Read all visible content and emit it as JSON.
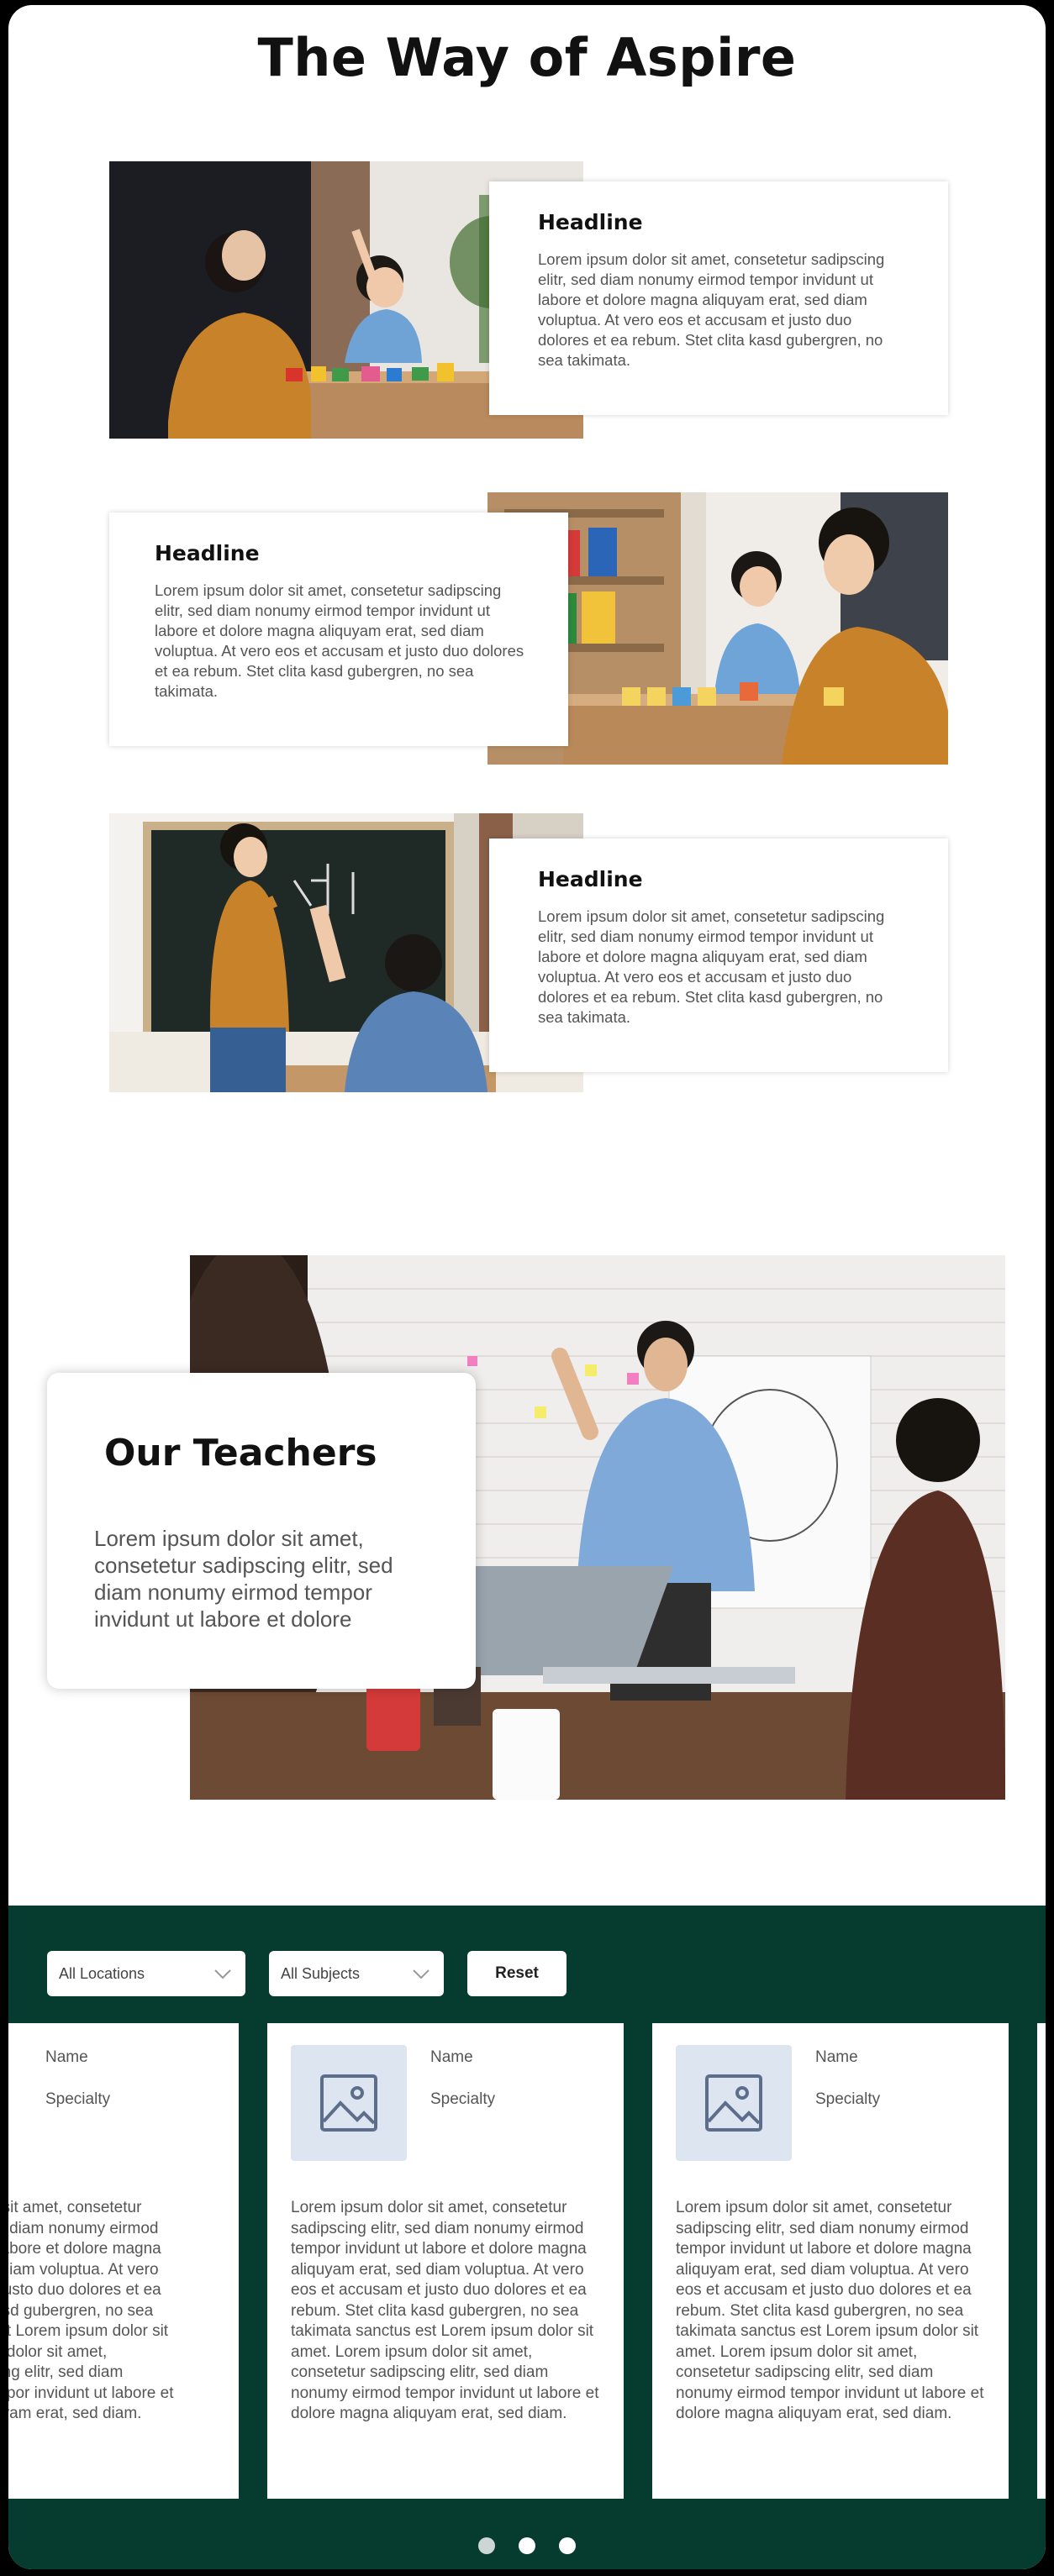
{
  "page_title": "The Way of Aspire",
  "features": [
    {
      "headline": "Headline",
      "body": "Lorem ipsum dolor sit amet, consetetur sadipscing elitr, sed diam nonumy eirmod tempor invidunt ut labore et dolore magna aliquyam erat, sed diam voluptua. At vero eos et accusam et justo duo dolores et ea rebum. Stet clita kasd gubergren, no sea takimata."
    },
    {
      "headline": "Headline",
      "body": "Lorem ipsum dolor sit amet, consetetur sadipscing elitr, sed diam nonumy eirmod tempor invidunt ut labore et dolore magna aliquyam erat, sed diam voluptua. At vero eos et accusam et justo duo dolores et ea rebum. Stet clita kasd gubergren, no sea takimata."
    },
    {
      "headline": "Headline",
      "body": "Lorem ipsum dolor sit amet, consetetur sadipscing elitr, sed diam nonumy eirmod tempor invidunt ut labore et dolore magna aliquyam erat, sed diam voluptua. At vero eos et accusam et justo duo dolores et ea rebum. Stet clita kasd gubergren, no sea takimata."
    }
  ],
  "teachers_hero": {
    "title": "Our Teachers",
    "body": "Lorem ipsum dolor sit amet, consetetur sadipscing elitr, sed diam nonumy eirmod tempor invidunt ut labore et dolore"
  },
  "filters": {
    "location": "All Locations",
    "subject": "All Subjects",
    "reset_label": "Reset"
  },
  "teacher_cards": [
    {
      "name": "Name",
      "specialty": "Specialty",
      "bio": "Lorem ipsum dolor sit amet, consetetur sadipscing elitr, sed diam nonumy eirmod tempor invidunt ut labore et dolore magna aliquyam erat, sed diam voluptua. At vero eos et accusam et justo duo dolores et ea rebum. Stet clita kasd gubergren, no sea takimata sanctus est Lorem ipsum dolor sit amet. Lorem ipsum dolor sit amet, consetetur sadipscing elitr, sed diam nonumy eirmod tempor invidunt ut labore et dolore magna aliquyam erat, sed diam."
    },
    {
      "name": "Name",
      "specialty": "Specialty",
      "bio": "Lorem ipsum dolor sit amet, consetetur sadipscing elitr, sed diam nonumy eirmod tempor invidunt ut labore et dolore magna aliquyam erat, sed diam voluptua. At vero eos et accusam et justo duo dolores et ea rebum. Stet clita kasd gubergren, no sea takimata sanctus est Lorem ipsum dolor sit amet. Lorem ipsum dolor sit amet, consetetur sadipscing elitr, sed diam nonumy eirmod tempor invidunt ut labore et dolore magna aliquyam erat, sed diam."
    },
    {
      "name": "Name",
      "specialty": "Specialty",
      "bio": "Lorem ipsum dolor sit amet, consetetur sadipscing elitr, sed diam nonumy eirmod tempor invidunt ut labore et dolore magna aliquyam erat, sed diam voluptua. At vero eos et accusam et justo duo dolores et ea rebum. Stet clita kasd gubergren, no sea takimata sanctus est Lorem ipsum dolor sit amet. Lorem ipsum dolor sit amet, consetetur sadipscing elitr, sed diam nonumy eirmod tempor invidunt ut labore et dolore magna aliquyam erat, sed diam."
    }
  ],
  "carousel": {
    "pages": 3,
    "active": 2
  },
  "colors": {
    "section_bg": "#063b2f",
    "sweater": "#c8832a",
    "avatar_bg": "#dde6f0"
  },
  "icons": [
    "chevron-down-icon",
    "image-placeholder-icon"
  ]
}
